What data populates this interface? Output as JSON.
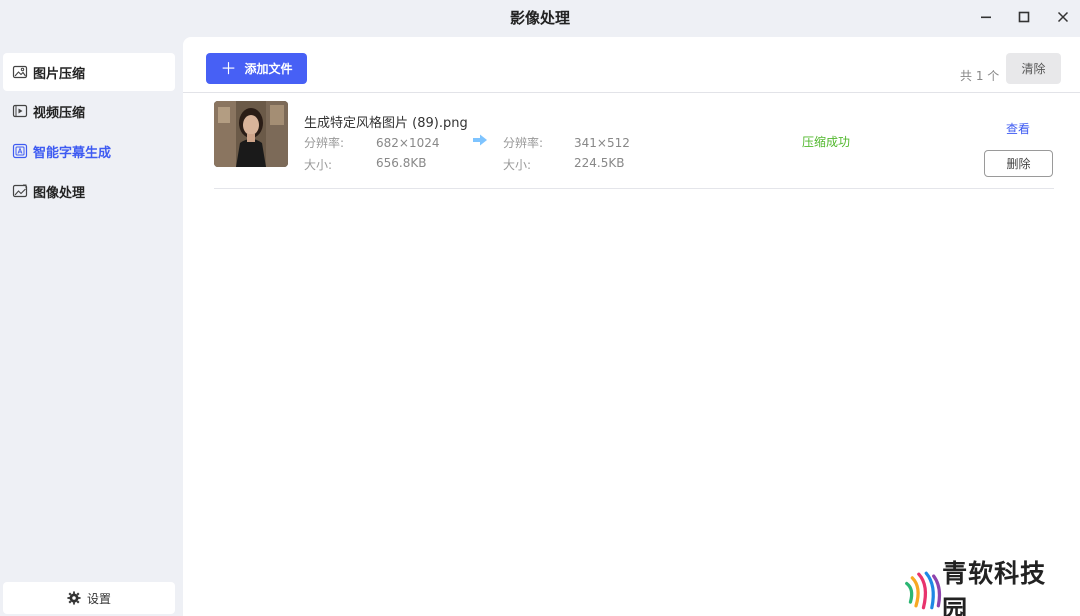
{
  "window": {
    "title": "影像处理",
    "controls": {
      "minimize": "minimize-icon",
      "maximize": "maximize-icon",
      "close": "close-icon"
    }
  },
  "sidebar": {
    "items": [
      {
        "label": "图片压缩",
        "icon": "image-icon",
        "background": "#ffffff",
        "color": "#222222"
      },
      {
        "label": "视频压缩",
        "icon": "video-icon",
        "color": "#222222"
      },
      {
        "label": "智能字幕生成",
        "icon": "subtitle-icon",
        "color": "#3e5bf2"
      },
      {
        "label": "图像处理",
        "icon": "image-edit-icon",
        "color": "#222222"
      }
    ],
    "settings_label": "设置"
  },
  "toolbar": {
    "add_label": "添加文件",
    "count_text": "共 1 个",
    "clear_label": "清除"
  },
  "files": [
    {
      "name": "生成特定风格图片 (89).png",
      "original": {
        "resolution_label": "分辨率:",
        "resolution": "682×1024",
        "size_label": "大小:",
        "size": "656.8KB"
      },
      "compressed": {
        "resolution_label": "分辨率:",
        "resolution": "341×512",
        "size_label": "大小:",
        "size": "224.5KB"
      },
      "status": "压缩成功",
      "view_label": "查看",
      "delete_label": "删除"
    }
  ],
  "colors": {
    "accent": "#4760f5",
    "link": "#3e5bf2",
    "success": "#52b82e",
    "background": "#eef0f5"
  },
  "watermark": {
    "text": "青软科技园"
  }
}
